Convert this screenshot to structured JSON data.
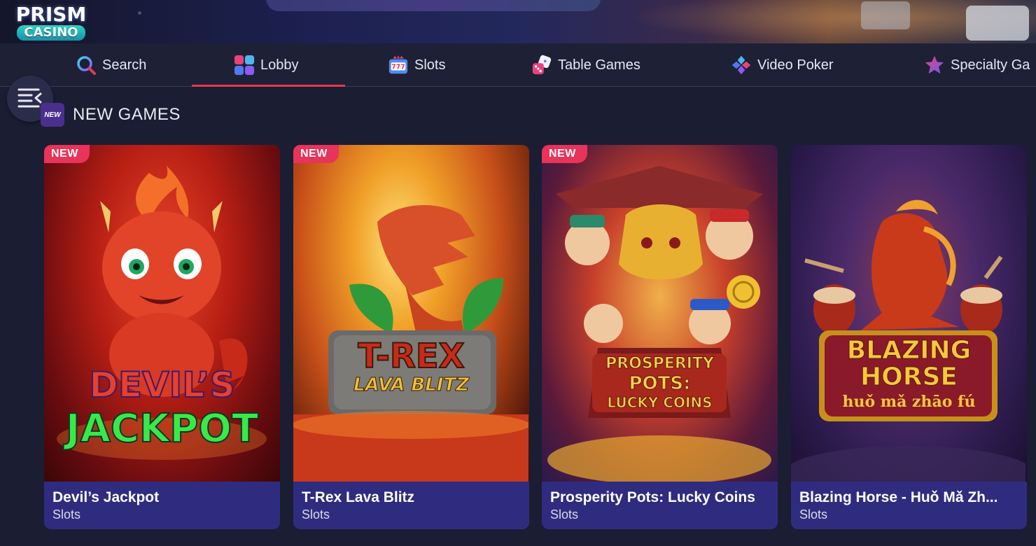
{
  "brand": {
    "logo_top": "PRISM",
    "logo_bottom": "CASINO"
  },
  "nav": {
    "items": [
      {
        "label": "Search",
        "icon": "search-icon"
      },
      {
        "label": "Lobby",
        "icon": "lobby-icon",
        "active": true
      },
      {
        "label": "Slots",
        "icon": "slots-icon"
      },
      {
        "label": "Table Games",
        "icon": "dice-icon"
      },
      {
        "label": "Video Poker",
        "icon": "card-suits-icon"
      },
      {
        "label": "Specialty Ga",
        "icon": "star-icon"
      }
    ],
    "active_color": "#e8384f"
  },
  "section": {
    "badge": "NEW",
    "title": "NEW GAMES"
  },
  "games": [
    {
      "tag": "NEW",
      "name": "Devil’s Jackpot",
      "category": "Slots",
      "art_line1": "DEVIL’S",
      "art_line2": "JACKPOT"
    },
    {
      "tag": "NEW",
      "name": "T-Rex Lava Blitz",
      "category": "Slots",
      "art_line1": "T-REX",
      "art_line2": "LAVA BLITZ"
    },
    {
      "tag": "NEW",
      "name": "Prosperity Pots: Lucky Coins",
      "category": "Slots",
      "art_line1": "PROSPERITY",
      "art_line2": "POTS:",
      "art_line3": "LUCKY COINS"
    },
    {
      "name": "Blazing Horse - Huǒ Mǎ Zh...",
      "category": "Slots",
      "art_line1": "BLAZING",
      "art_line2": "HORSE",
      "art_line3": "huǒ mǎ zhāo fú"
    }
  ],
  "colors": {
    "background": "#1b1d33",
    "card_info": "#2f2c80",
    "new_tag": "#e8335a"
  }
}
